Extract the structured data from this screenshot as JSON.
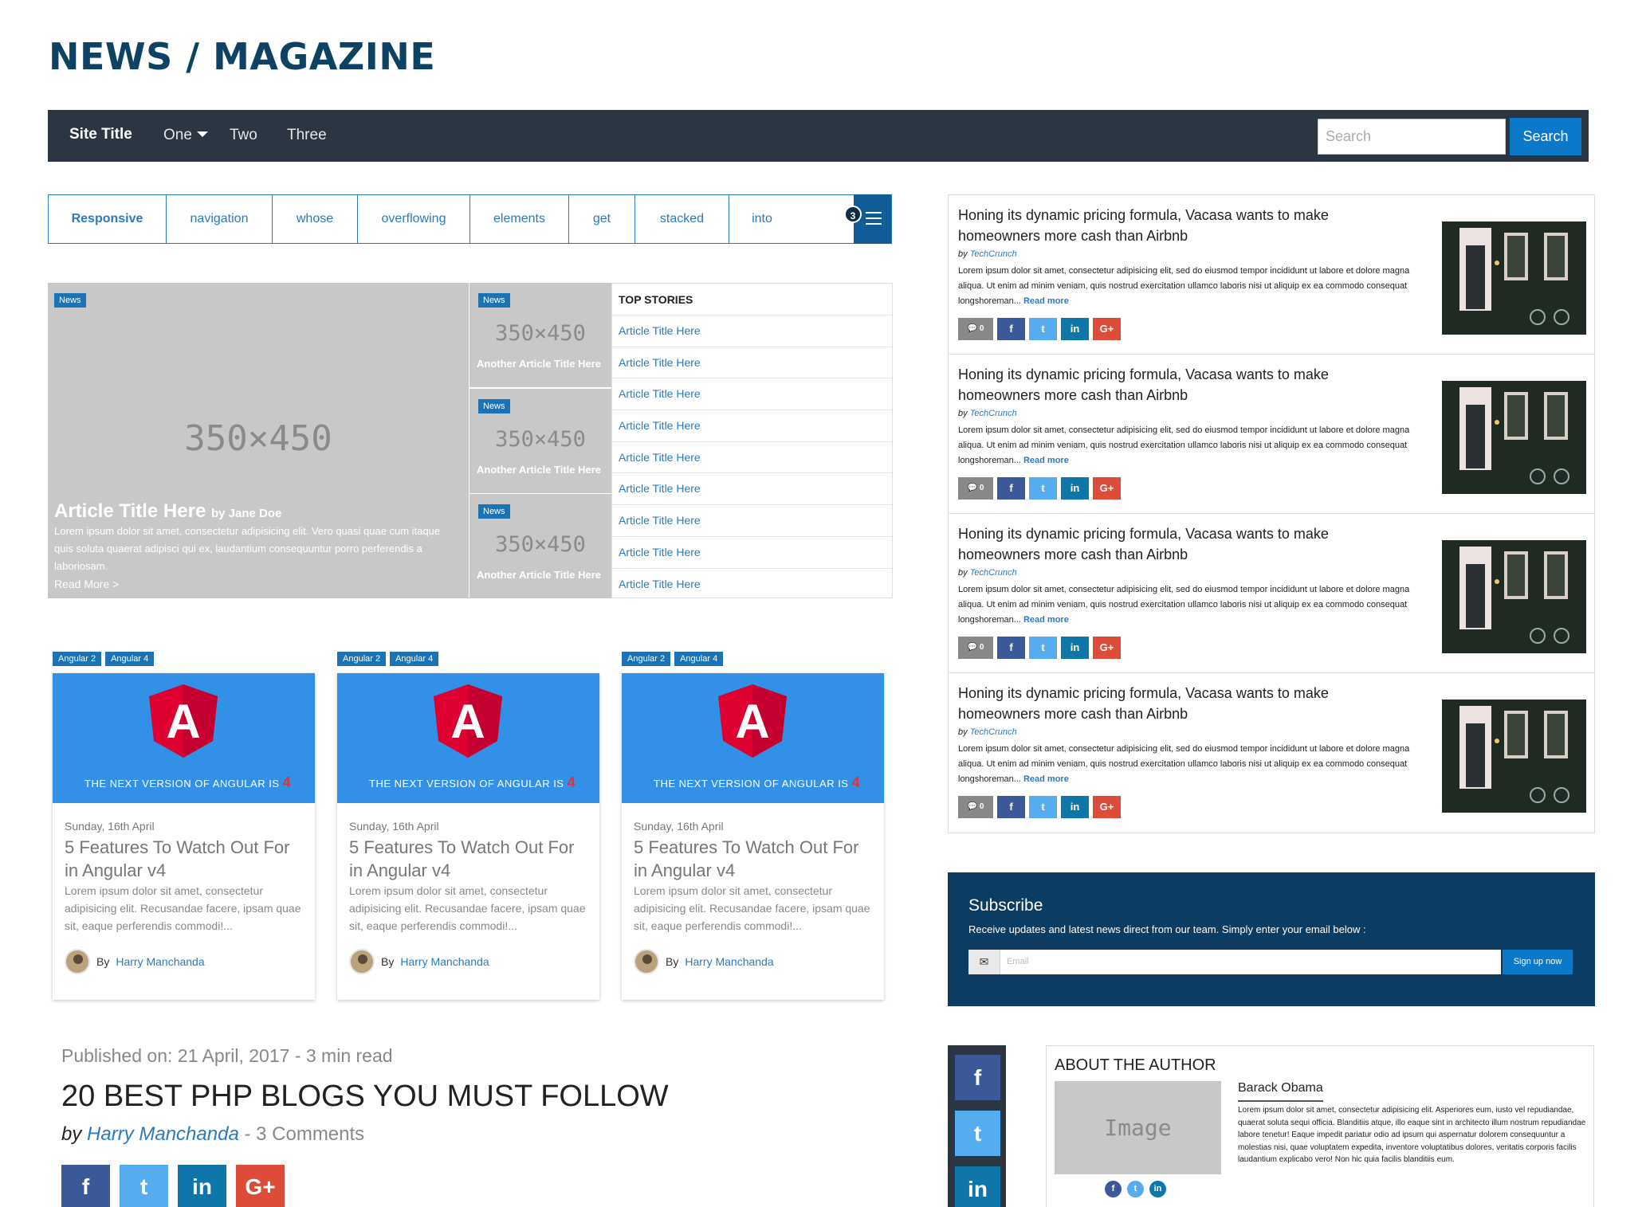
{
  "heading": "NEWS / MAGAZINE",
  "navbar": {
    "brand": "Site Title",
    "links": [
      "One",
      "Two",
      "Three"
    ],
    "search_placeholder": "Search",
    "search_button": "Search"
  },
  "tabs": {
    "items": [
      "Responsive",
      "navigation",
      "whose",
      "overflowing",
      "elements",
      "get",
      "stacked",
      "into"
    ],
    "overflow_count": "3"
  },
  "hero": {
    "label": "News",
    "placeholder": "350×450",
    "title": "Article Title Here",
    "author": "by Jane Doe",
    "desc": "Lorem ipsum dolor sit amet, consectetur adipisicing elit. Vero quasi quae cum itaque quis soluta quaerat adipisci qui ex, laudantium consequuntur porro perferendis a laboriosam.",
    "read_more": "Read More >"
  },
  "side_articles": [
    {
      "label": "News",
      "placeholder": "350×450",
      "title": "Another Article Title Here"
    },
    {
      "label": "News",
      "placeholder": "350×450",
      "title": "Another Article Title Here"
    },
    {
      "label": "News",
      "placeholder": "350×450",
      "title": "Another Article Title Here"
    }
  ],
  "top_stories": {
    "title": "TOP STORIES",
    "items": [
      "Article Title Here",
      "Article Title Here",
      "Article Title Here",
      "Article Title Here",
      "Article Title Here",
      "Article Title Here",
      "Article Title Here",
      "Article Title Here",
      "Article Title Here"
    ]
  },
  "cards": [
    {
      "tags": [
        "Angular 2",
        "Angular 4"
      ],
      "banner": "THE NEXT VERSION OF ANGULAR IS",
      "banner_num": "4",
      "date": "Sunday, 16th April",
      "title": "5 Features To Watch Out For in Angular v4",
      "body": "Lorem ipsum dolor sit amet, consectetur adipisicing elit. Recusandae facere, ipsam quae sit, eaque perferendis commodi!...",
      "by": "By",
      "author": "Harry Manchanda"
    },
    {
      "tags": [
        "Angular 2",
        "Angular 4"
      ],
      "banner": "THE NEXT VERSION OF ANGULAR IS",
      "banner_num": "4",
      "date": "Sunday, 16th April",
      "title": "5 Features To Watch Out For in Angular v4",
      "body": "Lorem ipsum dolor sit amet, consectetur adipisicing elit. Recusandae facere, ipsam quae sit, eaque perferendis commodi!...",
      "by": "By",
      "author": "Harry Manchanda"
    },
    {
      "tags": [
        "Angular 2",
        "Angular 4"
      ],
      "banner": "THE NEXT VERSION OF ANGULAR IS",
      "banner_num": "4",
      "date": "Sunday, 16th April",
      "title": "5 Features To Watch Out For in Angular v4",
      "body": "Lorem ipsum dolor sit amet, consectetur adipisicing elit. Recusandae facere, ipsam quae sit, eaque perferendis commodi!...",
      "by": "By",
      "author": "Harry Manchanda"
    }
  ],
  "feed": [
    {
      "headline": "Honing its dynamic pricing formula, Vacasa wants to make homeowners more cash than Airbnb",
      "by": "by",
      "source": "TechCrunch",
      "text": "Lorem ipsum dolor sit amet, consectetur adipisicing elit, sed do eiusmod tempor incididunt ut labore et dolore magna aliqua. Ut enim ad minim veniam, quis nostrud exercitation ullamco laboris nisi ut aliquip ex ea commodo consequat longshoreman...",
      "read_more": "Read more",
      "comments": "0"
    },
    {
      "headline": "Honing its dynamic pricing formula, Vacasa wants to make homeowners more cash than Airbnb",
      "by": "by",
      "source": "TechCrunch",
      "text": "Lorem ipsum dolor sit amet, consectetur adipisicing elit, sed do eiusmod tempor incididunt ut labore et dolore magna aliqua. Ut enim ad minim veniam, quis nostrud exercitation ullamco laboris nisi ut aliquip ex ea commodo consequat longshoreman...",
      "read_more": "Read more",
      "comments": "0"
    },
    {
      "headline": "Honing its dynamic pricing formula, Vacasa wants to make homeowners more cash than Airbnb",
      "by": "by",
      "source": "TechCrunch",
      "text": "Lorem ipsum dolor sit amet, consectetur adipisicing elit, sed do eiusmod tempor incididunt ut labore et dolore magna aliqua. Ut enim ad minim veniam, quis nostrud exercitation ullamco laboris nisi ut aliquip ex ea commodo consequat longshoreman...",
      "read_more": "Read more",
      "comments": "0"
    },
    {
      "headline": "Honing its dynamic pricing formula, Vacasa wants to make homeowners more cash than Airbnb",
      "by": "by",
      "source": "TechCrunch",
      "text": "Lorem ipsum dolor sit amet, consectetur adipisicing elit, sed do eiusmod tempor incididunt ut labore et dolore magna aliqua. Ut enim ad minim veniam, quis nostrud exercitation ullamco laboris nisi ut aliquip ex ea commodo consequat longshoreman...",
      "read_more": "Read more",
      "comments": "0"
    }
  ],
  "subscribe": {
    "title": "Subscribe",
    "desc": "Receive updates and latest news direct from our team. Simply enter your email below :",
    "placeholder": "Email",
    "button": "Sign up now"
  },
  "post": {
    "published": "Published on: 21 April, 2017 - 3 min read",
    "title": "20 BEST PHP BLOGS YOU MUST FOLLOW",
    "by": "by",
    "author": "Harry Manchanda",
    "comments": " - 3 Comments"
  },
  "about": {
    "title": "ABOUT THE AUTHOR",
    "image": "Image",
    "name": "Barack Obama",
    "bio": "Lorem ipsum dolor sit amet, consectetur adipisicing elit. Asperiores eum, iusto vel repudiandae, quaerat soluta sequi officia. Blanditiis atque, illo eaque sint in architecto illum nostrum repudiandae labore tenetur! Eaque impedit pariatur odio ad ipsum qui aspernatur dolorem consequuntur a molestias nisi, quae voluptatem expedita, inventore voluptatibus dolores, veritatis corporis facilis laudantium explicabo vero! Non hic quia facilis blanditiis eum."
  },
  "social_glyphs": {
    "facebook": "f",
    "twitter": "t",
    "linkedin": "in",
    "google": "G+"
  },
  "colors": {
    "heading": "#0d4263",
    "navbar": "#2b3642",
    "accent": "#0c78c9",
    "facebook": "#3b5998",
    "twitter": "#55acee",
    "linkedin": "#0e76a8",
    "google": "#dd4b39",
    "subscribe": "#0d3c63"
  }
}
